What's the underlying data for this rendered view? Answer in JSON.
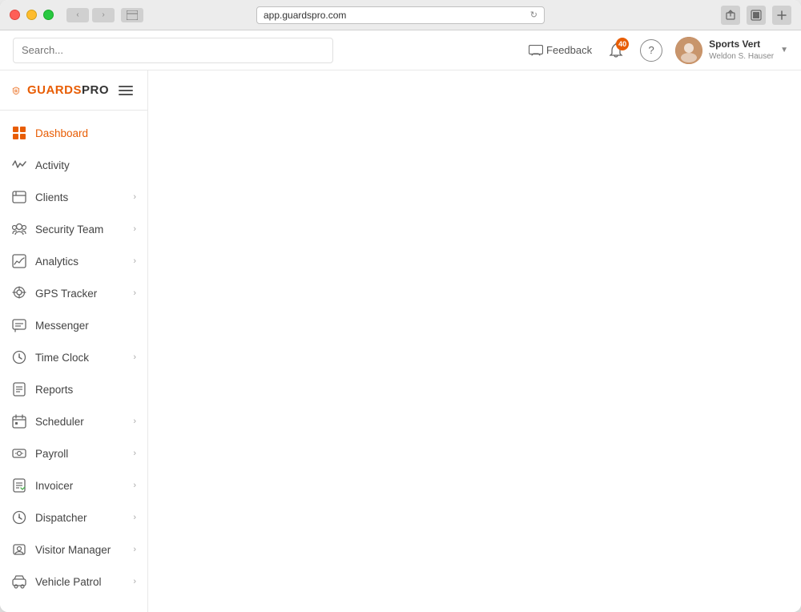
{
  "window": {
    "url": "app.guardspro.com"
  },
  "logo": {
    "text_guards": "GUARDS",
    "text_pro": "PRO"
  },
  "topbar": {
    "search_placeholder": "Search...",
    "feedback_label": "Feedback",
    "notif_count": "40",
    "user_name": "Sports Vert",
    "user_sub": "Weldon S. Hauser"
  },
  "sidebar": {
    "items": [
      {
        "id": "dashboard",
        "label": "Dashboard",
        "has_chevron": false,
        "active": true
      },
      {
        "id": "activity",
        "label": "Activity",
        "has_chevron": false,
        "active": false
      },
      {
        "id": "clients",
        "label": "Clients",
        "has_chevron": true,
        "active": false
      },
      {
        "id": "security-team",
        "label": "Security Team",
        "has_chevron": true,
        "active": false
      },
      {
        "id": "analytics",
        "label": "Analytics",
        "has_chevron": true,
        "active": false
      },
      {
        "id": "gps-tracker",
        "label": "GPS Tracker",
        "has_chevron": true,
        "active": false
      },
      {
        "id": "messenger",
        "label": "Messenger",
        "has_chevron": false,
        "active": false
      },
      {
        "id": "time-clock",
        "label": "Time Clock",
        "has_chevron": true,
        "active": false
      },
      {
        "id": "reports",
        "label": "Reports",
        "has_chevron": false,
        "active": false
      },
      {
        "id": "scheduler",
        "label": "Scheduler",
        "has_chevron": true,
        "active": false
      },
      {
        "id": "payroll",
        "label": "Payroll",
        "has_chevron": true,
        "active": false
      },
      {
        "id": "invoicer",
        "label": "Invoicer",
        "has_chevron": true,
        "active": false
      },
      {
        "id": "dispatcher",
        "label": "Dispatcher",
        "has_chevron": true,
        "active": false
      },
      {
        "id": "visitor-manager",
        "label": "Visitor Manager",
        "has_chevron": true,
        "active": false
      },
      {
        "id": "vehicle-patrol",
        "label": "Vehicle Patrol",
        "has_chevron": true,
        "active": false
      }
    ]
  }
}
